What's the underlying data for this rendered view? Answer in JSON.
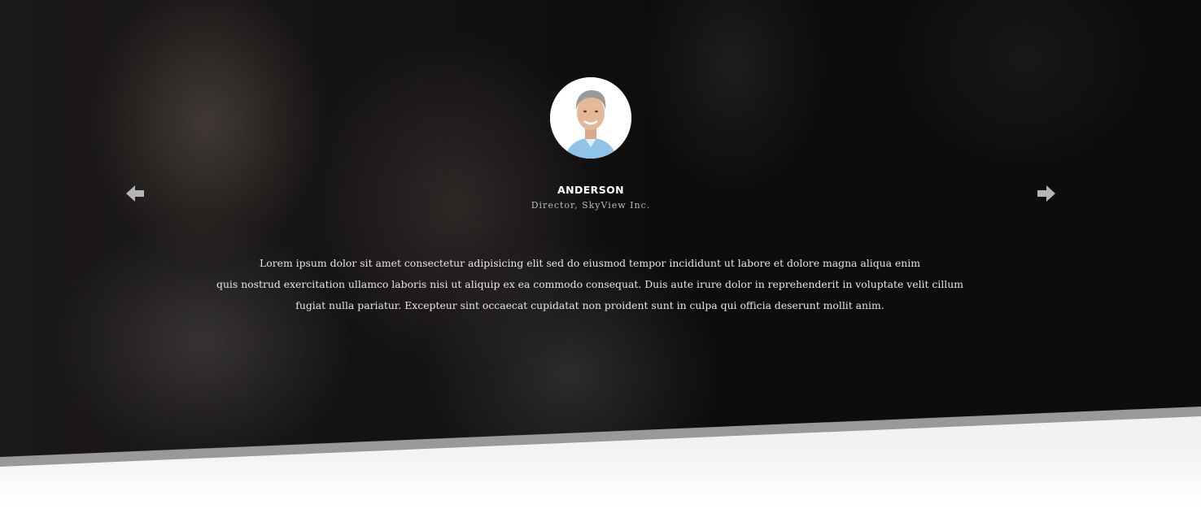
{
  "testimonial": {
    "name": "ANDERSON",
    "role": "Director, SkyView Inc.",
    "quote_lines": [
      "Lorem ipsum dolor sit amet consectetur adipisicing elit sed do eiusmod tempor incididunt ut labore et dolore magna aliqua enim",
      "quis nostrud exercitation ullamco laboris nisi ut aliquip ex ea commodo consequat. Duis aute irure dolor in reprehenderit in voluptate velit cillum",
      "fugiat nulla pariatur. Excepteur sint occaecat cupidatat non proident sunt in culpa qui officia deserunt mollit anim."
    ]
  },
  "icons": {
    "prev": "arrow-left-icon",
    "next": "arrow-right-icon"
  },
  "colors": {
    "arrow": "#b5b5b5",
    "text": "#e6e6e6",
    "muted": "#b9b9b9"
  }
}
